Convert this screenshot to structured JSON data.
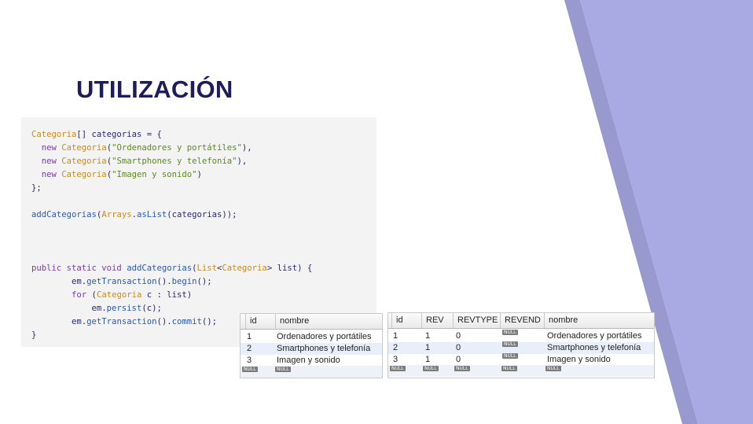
{
  "slide": {
    "title": "UTILIZACIÓN",
    "colors": {
      "title": "#1e1d5c",
      "accent_light": "#a9aae3",
      "accent_dark": "#9899cf"
    }
  },
  "code": {
    "lines": [
      [
        {
          "t": "Categoria",
          "c": "cls"
        },
        {
          "t": "[] categorias = {",
          "c": "pl"
        }
      ],
      [
        {
          "t": "  new ",
          "c": "kw"
        },
        {
          "t": "Categoria",
          "c": "cls"
        },
        {
          "t": "(",
          "c": "pl"
        },
        {
          "t": "\"Ordenadores y portátiles\"",
          "c": "str"
        },
        {
          "t": "),",
          "c": "pl"
        }
      ],
      [
        {
          "t": "  new ",
          "c": "kw"
        },
        {
          "t": "Categoria",
          "c": "cls"
        },
        {
          "t": "(",
          "c": "pl"
        },
        {
          "t": "\"Smartphones y telefonía\"",
          "c": "str"
        },
        {
          "t": "),",
          "c": "pl"
        }
      ],
      [
        {
          "t": "  new ",
          "c": "kw"
        },
        {
          "t": "Categoria",
          "c": "cls"
        },
        {
          "t": "(",
          "c": "pl"
        },
        {
          "t": "\"Imagen y sonido\"",
          "c": "str"
        },
        {
          "t": ")",
          "c": "pl"
        }
      ],
      [
        {
          "t": "};",
          "c": "pl"
        }
      ],
      [],
      [
        {
          "t": "addCategorias",
          "c": "fn"
        },
        {
          "t": "(",
          "c": "pl"
        },
        {
          "t": "Arrays",
          "c": "cls"
        },
        {
          "t": ".",
          "c": "pl"
        },
        {
          "t": "asList",
          "c": "fn"
        },
        {
          "t": "(categorias));",
          "c": "pl"
        }
      ],
      [],
      [],
      [],
      [
        {
          "t": "public static void ",
          "c": "kw"
        },
        {
          "t": "addCategorias",
          "c": "fn"
        },
        {
          "t": "(",
          "c": "pl"
        },
        {
          "t": "List",
          "c": "cls"
        },
        {
          "t": "<",
          "c": "pl"
        },
        {
          "t": "Categoria",
          "c": "cls"
        },
        {
          "t": "> list) {",
          "c": "pl"
        }
      ],
      [
        {
          "t": "        em.",
          "c": "pl"
        },
        {
          "t": "getTransaction",
          "c": "fn"
        },
        {
          "t": "().",
          "c": "pl"
        },
        {
          "t": "begin",
          "c": "fn"
        },
        {
          "t": "();",
          "c": "pl"
        }
      ],
      [
        {
          "t": "        for ",
          "c": "kw"
        },
        {
          "t": "(",
          "c": "pl"
        },
        {
          "t": "Categoria",
          "c": "cls"
        },
        {
          "t": " c : list)",
          "c": "pl"
        }
      ],
      [
        {
          "t": "            em.",
          "c": "pl"
        },
        {
          "t": "persist",
          "c": "fn"
        },
        {
          "t": "(c);",
          "c": "pl"
        }
      ],
      [
        {
          "t": "        em.",
          "c": "pl"
        },
        {
          "t": "getTransaction",
          "c": "fn"
        },
        {
          "t": "().",
          "c": "pl"
        },
        {
          "t": "commit",
          "c": "fn"
        },
        {
          "t": "();",
          "c": "pl"
        }
      ],
      [
        {
          "t": "}",
          "c": "pl"
        }
      ]
    ]
  },
  "table1": {
    "columns": [
      "id",
      "nombre"
    ],
    "rows": [
      [
        "1",
        "Ordenadores y portátiles"
      ],
      [
        "2",
        "Smartphones y telefonía"
      ],
      [
        "3",
        "Imagen y sonido"
      ]
    ],
    "null_label": "NULL"
  },
  "table2": {
    "columns": [
      "id",
      "REV",
      "REVTYPE",
      "REVEND",
      "nombre"
    ],
    "rows": [
      [
        "1",
        "1",
        "0",
        "NULL",
        "Ordenadores y portátiles"
      ],
      [
        "2",
        "1",
        "0",
        "NULL",
        "Smartphones y telefonía"
      ],
      [
        "3",
        "1",
        "0",
        "NULL",
        "Imagen y sonido"
      ]
    ],
    "null_label": "NULL"
  }
}
